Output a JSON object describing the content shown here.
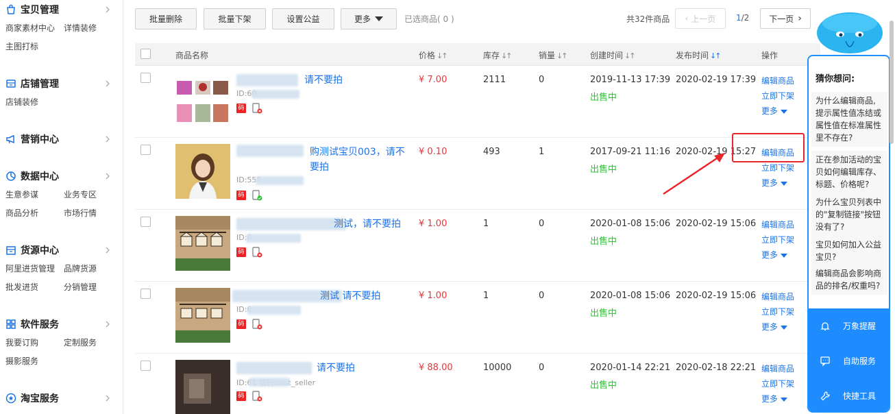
{
  "sidebar": {
    "sections": [
      {
        "title": "宝贝管理",
        "icon": "shopping-bag-icon",
        "items": [
          "商家素材中心",
          "详情装修",
          "主图打标"
        ]
      },
      {
        "title": "店铺管理",
        "icon": "store-icon",
        "items": [
          "店铺装修"
        ]
      },
      {
        "title": "营销中心",
        "icon": "megaphone-icon",
        "items": []
      },
      {
        "title": "数据中心",
        "icon": "analytics-icon",
        "items": [
          "生意参谋",
          "业务专区",
          "商品分析",
          "市场行情"
        ]
      },
      {
        "title": "货源中心",
        "icon": "warehouse-icon",
        "items": [
          "阿里进货管理",
          "品牌货源",
          "批发进货",
          "分销管理"
        ]
      },
      {
        "title": "软件服务",
        "icon": "apps-grid-icon",
        "items": [
          "我要订购",
          "定制服务",
          "摄影服务"
        ]
      },
      {
        "title": "淘宝服务",
        "icon": "service-star-icon",
        "items": []
      }
    ]
  },
  "toolbar": {
    "batch_delete": "批量删除",
    "batch_offshelf": "批量下架",
    "set_charity": "设置公益",
    "more": "更多",
    "selected_count": "已选商品( 0 )",
    "total": "共32件商品",
    "prev_page": "上一页",
    "page_current": "1",
    "page_total": "/2",
    "next_page": "下一页"
  },
  "table": {
    "headers": {
      "name": "商品名称",
      "price": "价格",
      "stock": "库存",
      "sales": "销量",
      "created": "创建时间",
      "published": "发布时间",
      "actions": "操作"
    },
    "rows": [
      {
        "name_visible": "请不要拍",
        "id": "ID:60",
        "price": "¥ 7.00",
        "stock": "2111",
        "sales": "0",
        "created": "2019-11-13 17:39",
        "published": "2020-02-19 17:39",
        "status": "出售中",
        "mobile_badge": "mobile-error-icon"
      },
      {
        "name_visible": "购测试宝贝003，请不要拍",
        "id": "ID:559",
        "price": "¥ 0.10",
        "stock": "493",
        "sales": "1",
        "created": "2017-09-21 11:16",
        "published": "2020-02-19 15:27",
        "status": "出售中",
        "mobile_badge": "mobile-ok-icon"
      },
      {
        "name_visible": "测试，请不要拍",
        "id": "ID:6",
        "price": "¥ 1.00",
        "stock": "1",
        "sales": "0",
        "created": "2020-01-08 15:06",
        "published": "2020-02-19 15:06",
        "status": "出售中",
        "mobile_badge": "mobile-error-icon"
      },
      {
        "name_visible": "测试 请不要拍",
        "id": "ID:6",
        "price": "¥ 1.00",
        "stock": "1",
        "sales": "0",
        "created": "2020-01-08 15:06",
        "published": "2020-02-19 15:06",
        "status": "出售中",
        "mobile_badge": "mobile-error-icon"
      },
      {
        "name_visible": "请不要拍",
        "id": "ID:61 编码:test_seller",
        "price": "¥ 88.00",
        "stock": "10000",
        "sales": "0",
        "created": "2020-01-14 22:21",
        "published": "2020-02-18 22:21",
        "status": "出售中",
        "mobile_badge": "mobile-error-icon"
      }
    ],
    "actions": {
      "edit": "编辑商品",
      "offshelf": "立即下架",
      "more": "更多"
    },
    "code_badge": "码"
  },
  "helper": {
    "title": "猜你想问:",
    "questions": [
      "为什么编辑商品,提示属性值冻结或 属性值在标准属性里不存在?",
      "正在参加活动的宝贝如何编辑库存、标题、价格呢?",
      "为什么宝贝列表中的\"复制链接\"按钮没有了?",
      "宝贝如何加入公益宝贝?",
      "编辑商品会影响商品的排名/权重吗?"
    ],
    "footer": [
      {
        "label": "万象提醒",
        "icon": "bell-icon"
      },
      {
        "label": "自助服务",
        "icon": "chat-icon"
      },
      {
        "label": "快捷工具",
        "icon": "wrench-icon"
      }
    ]
  },
  "colors": {
    "accent": "#1a73e8",
    "price": "#e4393c",
    "status": "#2bc233",
    "helper_blue": "#1e8cff",
    "annotation_red": "#e8262b"
  }
}
